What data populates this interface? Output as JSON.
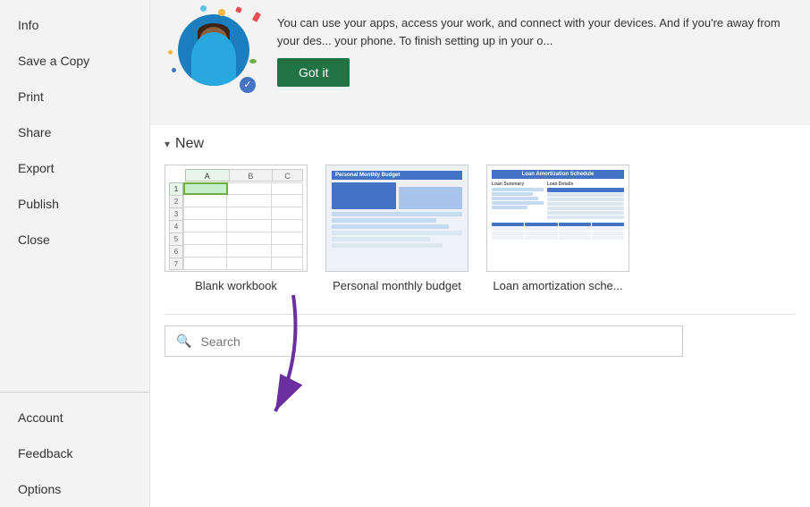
{
  "sidebar": {
    "items": [
      {
        "id": "info",
        "label": "Info"
      },
      {
        "id": "save-copy",
        "label": "Save a Copy"
      },
      {
        "id": "print",
        "label": "Print"
      },
      {
        "id": "share",
        "label": "Share"
      },
      {
        "id": "export",
        "label": "Export"
      },
      {
        "id": "publish",
        "label": "Publish"
      },
      {
        "id": "close",
        "label": "Close"
      }
    ],
    "bottom_items": [
      {
        "id": "account",
        "label": "Account"
      },
      {
        "id": "feedback",
        "label": "Feedback"
      },
      {
        "id": "options",
        "label": "Options"
      }
    ]
  },
  "notification": {
    "text": "You can use your apps, access your work, and connect with your devices. And if you're away from your des... your phone. To finish setting up in your o...",
    "button_label": "Got it"
  },
  "new_section": {
    "heading": "New",
    "templates": [
      {
        "id": "blank",
        "label": "Blank workbook"
      },
      {
        "id": "budget",
        "label": "Personal monthly budget"
      },
      {
        "id": "loan",
        "label": "Loan amortization sche..."
      }
    ]
  },
  "search": {
    "placeholder": "Search",
    "value": ""
  },
  "arrow": {
    "visible": true
  },
  "colors": {
    "accent_green": "#217346",
    "sidebar_bg": "#f3f3f3",
    "main_bg": "#ffffff"
  }
}
